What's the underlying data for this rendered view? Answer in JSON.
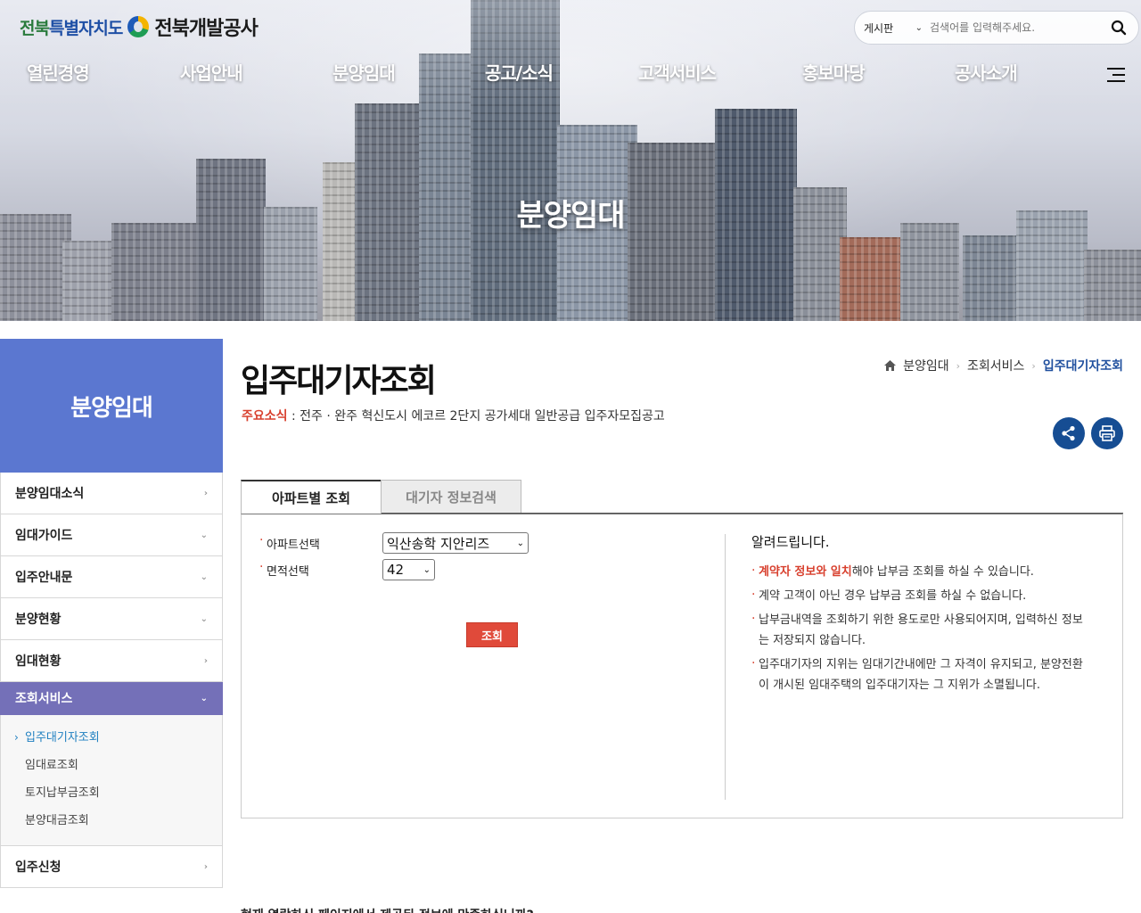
{
  "header": {
    "logo_province_a": "전북",
    "logo_province_b": "특별자치도",
    "logo_corp": "전북개발공사",
    "search_scope": "게시판",
    "search_placeholder": "검색어를 입력해주세요."
  },
  "gnb": [
    "열린경영",
    "사업안내",
    "분양임대",
    "공고/소식",
    "고객서비스",
    "홍보마당",
    "공사소개"
  ],
  "hero_title": "분양임대",
  "lnb": {
    "title": "분양임대",
    "items": [
      "분양임대소식",
      "임대가이드",
      "입주안내문",
      "분양현황",
      "임대현황",
      "조회서비스",
      "입주신청"
    ],
    "sub": [
      "입주대기자조회",
      "임대료조회",
      "토지납부금조회",
      "분양대금조회"
    ]
  },
  "page": {
    "title": "입주대기자조회",
    "breadcrumb": [
      "분양임대",
      "조회서비스",
      "입주대기자조회"
    ],
    "notice_label": "주요소식",
    "notice_text": " : 전주 · 완주 혁신도시 에코르 2단지 공가세대 일반공급 입주자모집공고"
  },
  "tabs": [
    "아파트별 조회",
    "대기자 정보검색"
  ],
  "form": {
    "apt_label": "아파트선택",
    "apt_value": "익산송학 지안리즈",
    "area_label": "면적선택",
    "area_value": "42",
    "submit": "조회"
  },
  "info": {
    "title": "알려드립니다.",
    "item1_red": "계약자 정보와 일치",
    "item1_rest": "해야 납부금 조회를 하실 수 있습니다.",
    "item2": "계약 고객이 아닌 경우 납부금 조회를 하실 수 없습니다.",
    "item3": "납부금내역을 조회하기 위한 용도로만 사용되어지며, 입력하신 정보는 저장되지 않습니다.",
    "item4": "입주대기자의 지위는 임대기간내에만 그 자격이 유지되고, 분양전환이 개시된 임대주택의 입주대기자는 그 지위가 소멸됩니다."
  },
  "bottom_question": "현재 열람하신 페이지에서 제공된 정보에 만족하십니까?"
}
